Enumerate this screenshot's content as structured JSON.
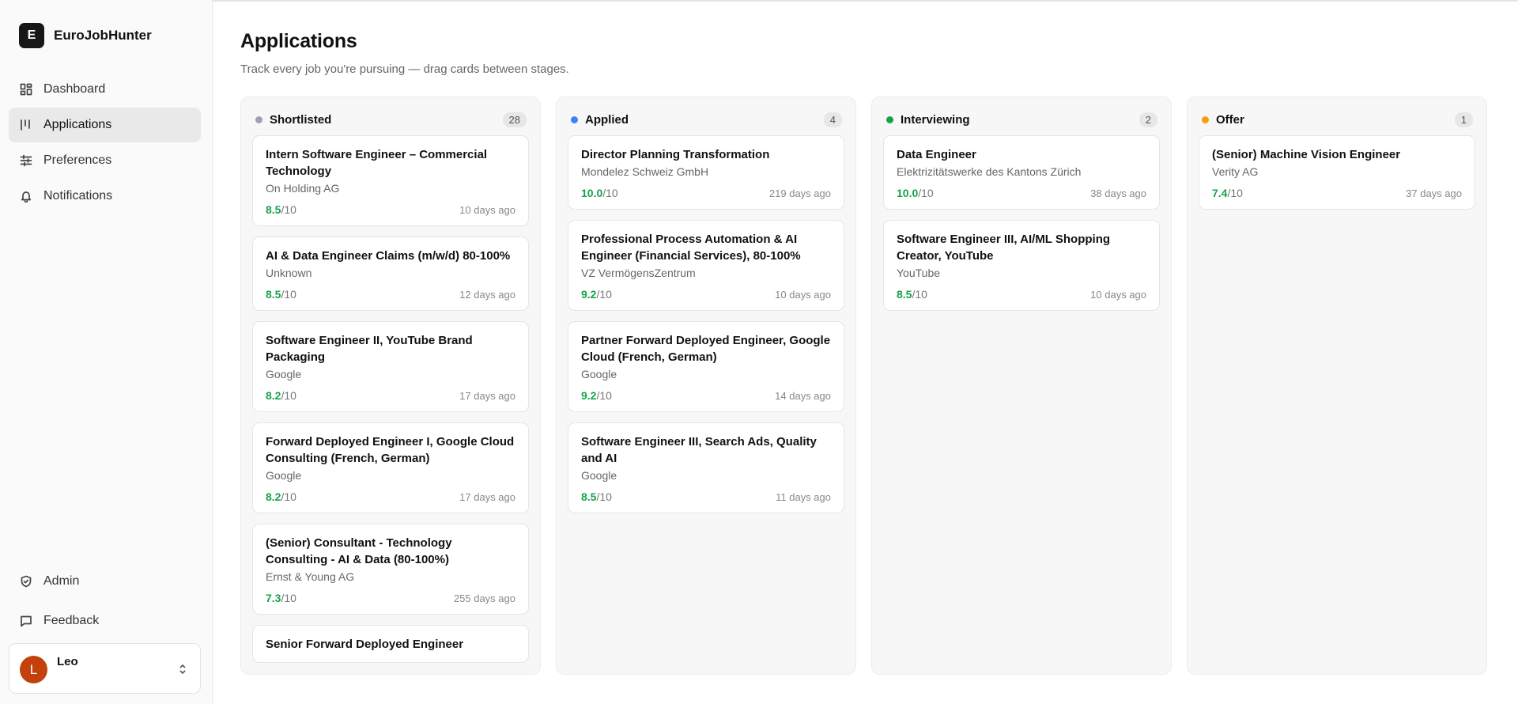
{
  "brand": {
    "logo_letter": "E",
    "name": "EuroJobHunter"
  },
  "nav": {
    "items": [
      {
        "label": "Dashboard",
        "icon": "dashboard-icon"
      },
      {
        "label": "Applications",
        "icon": "kanban-icon",
        "active": true
      },
      {
        "label": "Preferences",
        "icon": "sliders-icon"
      },
      {
        "label": "Notifications",
        "icon": "bell-icon"
      }
    ],
    "bottom": [
      {
        "label": "Admin",
        "icon": "shield-icon"
      },
      {
        "label": "Feedback",
        "icon": "message-icon"
      }
    ]
  },
  "user": {
    "initial": "L",
    "name": "Leo",
    "avatar_color": "#c2410c"
  },
  "page": {
    "title": "Applications",
    "subtitle": "Track every job you're pursuing — drag cards between stages."
  },
  "score_suffix": "/10",
  "columns": [
    {
      "title": "Shortlisted",
      "count": "28",
      "dot_color": "#9ca3af",
      "cards": [
        {
          "title": "Intern Software Engineer – Commercial Technology",
          "company": "On Holding AG",
          "score": "8.5",
          "age": "10 days ago"
        },
        {
          "title": "AI & Data Engineer Claims (m/w/d) 80-100%",
          "company": "Unknown",
          "score": "8.5",
          "age": "12 days ago"
        },
        {
          "title": "Software Engineer II, YouTube Brand Packaging",
          "company": "Google",
          "score": "8.2",
          "age": "17 days ago"
        },
        {
          "title": "Forward Deployed Engineer I, Google Cloud Consulting (French, German)",
          "company": "Google",
          "score": "8.2",
          "age": "17 days ago"
        },
        {
          "title": "(Senior) Consultant - Technology Consulting - AI & Data (80-100%)",
          "company": "Ernst & Young AG",
          "score": "7.3",
          "age": "255 days ago"
        },
        {
          "title": "Senior Forward Deployed Engineer",
          "company": "",
          "score": "",
          "age": ""
        }
      ]
    },
    {
      "title": "Applied",
      "count": "4",
      "dot_color": "#3b82f6",
      "cards": [
        {
          "title": "Director Planning Transformation",
          "company": "Mondelez Schweiz GmbH",
          "score": "10.0",
          "age": "219 days ago"
        },
        {
          "title": "Professional Process Automation & AI Engineer (Financial Services), 80-100%",
          "company": "VZ VermögensZentrum",
          "score": "9.2",
          "age": "10 days ago"
        },
        {
          "title": "Partner Forward Deployed Engineer, Google Cloud (French, German)",
          "company": "Google",
          "score": "9.2",
          "age": "14 days ago"
        },
        {
          "title": "Software Engineer III, Search Ads, Quality and AI",
          "company": "Google",
          "score": "8.5",
          "age": "11 days ago"
        }
      ]
    },
    {
      "title": "Interviewing",
      "count": "2",
      "dot_color": "#16a34a",
      "cards": [
        {
          "title": "Data Engineer",
          "company": "Elektrizitätswerke des Kantons Zürich",
          "score": "10.0",
          "age": "38 days ago"
        },
        {
          "title": "Software Engineer III, AI/ML Shopping Creator, YouTube",
          "company": "YouTube",
          "score": "8.5",
          "age": "10 days ago"
        }
      ]
    },
    {
      "title": "Offer",
      "count": "1",
      "dot_color": "#f59e0b",
      "cards": [
        {
          "title": "(Senior) Machine Vision Engineer",
          "company": "Verity AG",
          "score": "7.4",
          "age": "37 days ago"
        }
      ]
    }
  ]
}
